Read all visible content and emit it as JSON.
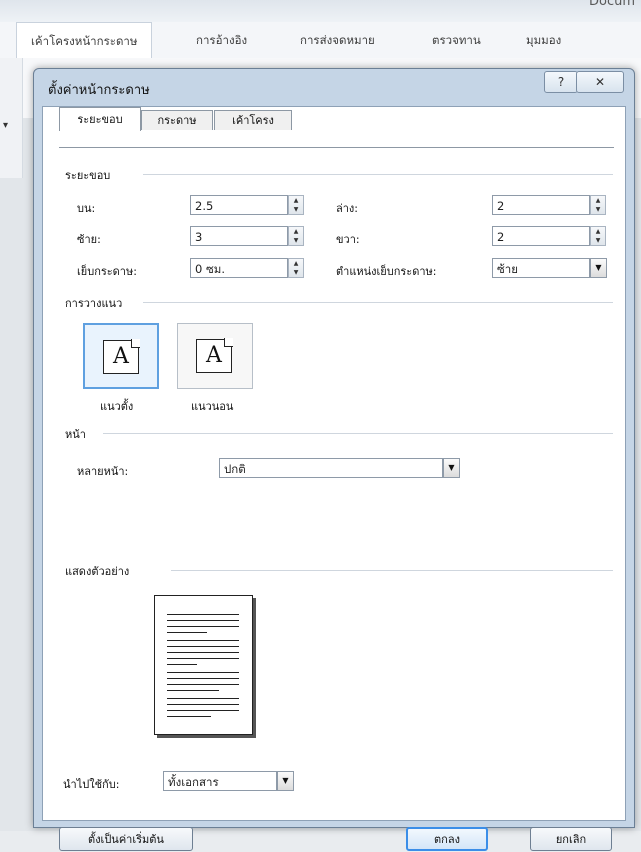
{
  "app": {
    "doc_title": "Docum"
  },
  "ribbon": {
    "tabs": [
      {
        "label": "เค้าโครงหน้ากระดาษ"
      },
      {
        "label": "การอ้างอิง"
      },
      {
        "label": "การส่งจดหมาย"
      },
      {
        "label": "ตรวจทาน"
      },
      {
        "label": "มุมมอง"
      }
    ]
  },
  "dialog": {
    "title": "ตั้งค่าหน้ากระดาษ",
    "help_label": "?",
    "close_label": "✕",
    "tabs": [
      {
        "label": "ระยะขอบ"
      },
      {
        "label": "กระดาษ"
      },
      {
        "label": "เค้าโครง"
      }
    ],
    "margins": {
      "section_label": "ระยะขอบ",
      "top_label": "บน:",
      "top_value": "2.5",
      "bottom_label": "ล่าง:",
      "bottom_value": "2",
      "left_label": "ซ้าย:",
      "left_value": "3",
      "right_label": "ขวา:",
      "right_value": "2",
      "gutter_label": "เย็บกระดาษ:",
      "gutter_value": "0 ซม.",
      "gutter_pos_label": "ตำแหน่งเย็บกระดาษ:",
      "gutter_pos_value": "ซ้าย"
    },
    "orientation": {
      "section_label": "การวางแนว",
      "portrait_label": "แนวตั้ง",
      "landscape_label": "แนวนอน",
      "glyph": "A"
    },
    "pages": {
      "section_label": "หน้า",
      "multiple_label": "หลายหน้า:",
      "multiple_value": "ปกติ"
    },
    "preview": {
      "section_label": "แสดงตัวอย่าง"
    },
    "apply": {
      "label": "นำไปใช้กับ:",
      "value": "ทั้งเอกสาร"
    },
    "buttons": {
      "default_label": "ตั้งเป็นค่าเริ่มต้น",
      "ok_label": "ตกลง",
      "cancel_label": "ยกเลิก"
    }
  }
}
